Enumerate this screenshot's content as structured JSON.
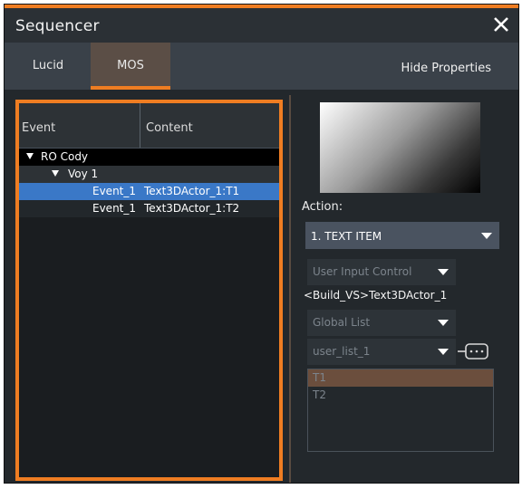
{
  "window": {
    "title": "Sequencer"
  },
  "tabs": [
    {
      "label": "Lucid",
      "active": false
    },
    {
      "label": "MOS",
      "active": true
    }
  ],
  "header": {
    "hide_properties_label": "Hide Properties"
  },
  "tree": {
    "columns": [
      "Event",
      "Content"
    ],
    "rows": [
      {
        "event": "RO Cody",
        "content": ""
      },
      {
        "event": "Voy 1",
        "content": ""
      },
      {
        "event": "Event_1",
        "content": "Text3DActor_1:T1"
      },
      {
        "event": "Event_1",
        "content": "Text3DActor_1:T2"
      }
    ]
  },
  "properties": {
    "action_label": "Action:",
    "action_value": "1. TEXT ITEM",
    "input_control_value": "User Input Control",
    "build_path": "<Build_VS>Text3DActor_1",
    "list_type_value": "Global List",
    "list_name_value": "user_list_1",
    "list_items": [
      "T1",
      "T2"
    ]
  },
  "colors": {
    "accent": "#ef7d22",
    "selection": "#3a78c7"
  }
}
